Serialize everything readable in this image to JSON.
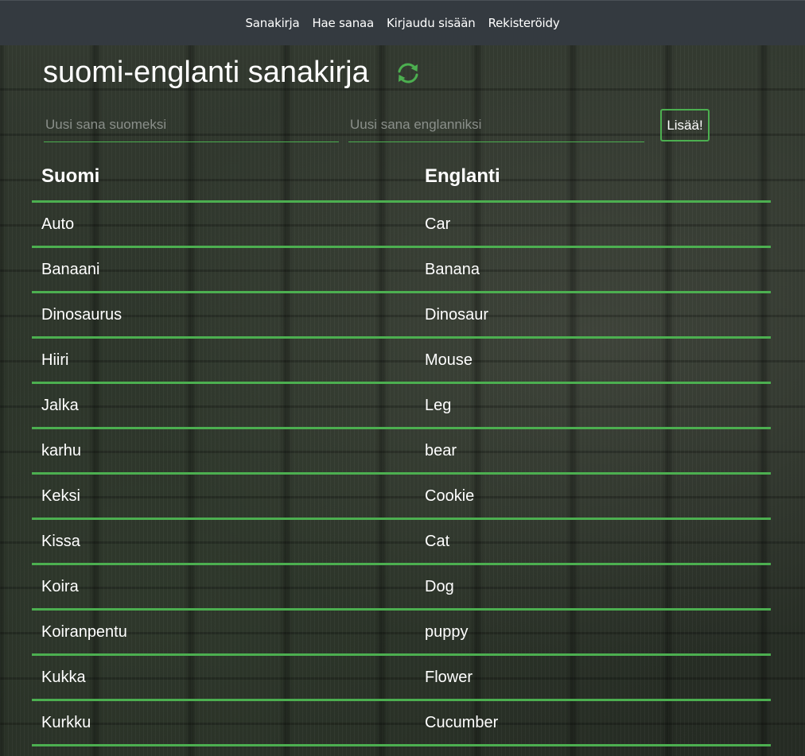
{
  "nav": {
    "items": [
      "Sanakirja",
      "Hae sanaa",
      "Kirjaudu sisään",
      "Rekisteröidy"
    ]
  },
  "page": {
    "title": "suomi-englanti sanakirja",
    "refresh_icon": "refresh-icon"
  },
  "form": {
    "finnish_placeholder": "Uusi sana suomeksi",
    "english_placeholder": "Uusi sana englanniksi",
    "finnish_value": "",
    "english_value": "",
    "add_label": "Lisää!"
  },
  "table": {
    "headers": [
      "Suomi",
      "Englanti"
    ],
    "rows": [
      [
        "Auto",
        "Car"
      ],
      [
        "Banaani",
        "Banana"
      ],
      [
        "Dinosaurus",
        "Dinosaur"
      ],
      [
        "Hiiri",
        "Mouse"
      ],
      [
        "Jalka",
        "Leg"
      ],
      [
        "karhu",
        "bear"
      ],
      [
        "Keksi",
        "Cookie"
      ],
      [
        "Kissa",
        "Cat"
      ],
      [
        "Koira",
        "Dog"
      ],
      [
        "Koiranpentu",
        "puppy"
      ],
      [
        "Kukka",
        "Flower"
      ],
      [
        "Kurkku",
        "Cucumber"
      ]
    ]
  },
  "colors": {
    "accent": "#4caf50",
    "navbar": "#343a40"
  }
}
